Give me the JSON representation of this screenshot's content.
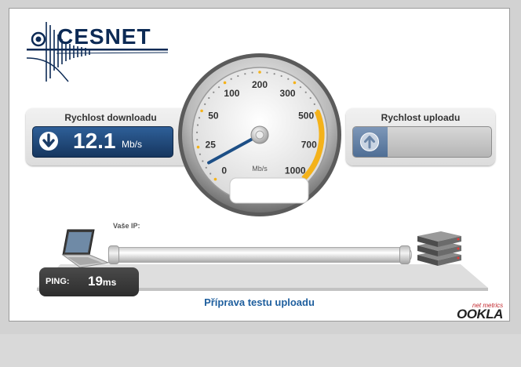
{
  "brand": {
    "logo_text": "CESNET"
  },
  "download": {
    "title": "Rychlost downloadu",
    "value": "12.1",
    "unit": "Mb/s",
    "icon": "download-arrow-icon"
  },
  "upload": {
    "title": "Rychlost uploadu",
    "icon": "upload-arrow-icon"
  },
  "gauge": {
    "labels": [
      "0",
      "25",
      "50",
      "100",
      "200",
      "300",
      "500",
      "700",
      "1000"
    ],
    "unit": "Mb/s",
    "needle_value_mbps": 12.1,
    "accent": "#f4b21a",
    "needle_color": "#1d4f86"
  },
  "connection": {
    "ip_label": "Vaše IP:"
  },
  "ping": {
    "label": "PING:",
    "value": "19",
    "unit": "ms"
  },
  "status": {
    "text": "Příprava testu uploadu"
  },
  "footer": {
    "ookla_small": "net metrics",
    "ookla_big": "OOKLA"
  }
}
